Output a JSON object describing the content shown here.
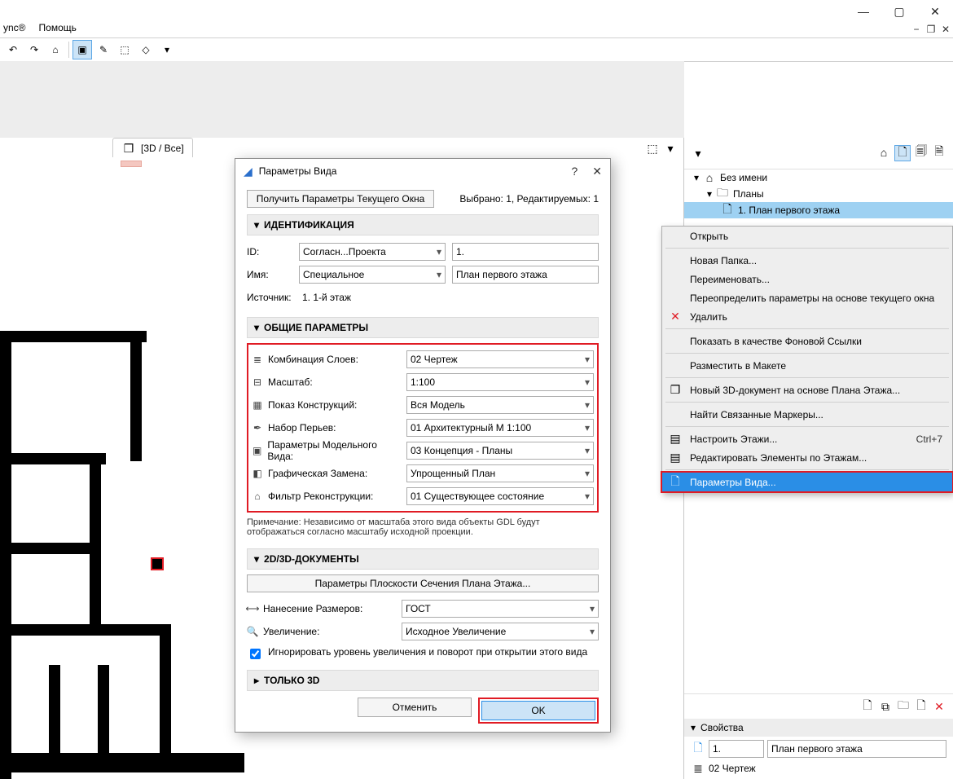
{
  "menubar": {
    "item0": "ync®",
    "item1": "Помощь"
  },
  "tab": {
    "label": "[3D / Все]"
  },
  "right_panel": {
    "root": "Без имени",
    "folder": "Планы",
    "selected_view": "1. План первого этажа",
    "props_header": "Свойства",
    "id_value": "1.",
    "name_value": "План первого этажа",
    "layer_value": "02 Чертеж"
  },
  "context_menu": {
    "open": "Открыть",
    "new_folder": "Новая Папка...",
    "rename": "Переименовать...",
    "redefine": "Переопределить параметры на основе текущего окна",
    "delete": "Удалить",
    "show_as_link": "Показать в качестве Фоновой Ссылки",
    "place_on_layout": "Разместить в Макете",
    "new_3d_doc": "Новый 3D-документ на основе Плана Этажа...",
    "find_markers": "Найти Связанные Маркеры...",
    "story_settings": "Настроить Этажи...",
    "story_settings_shortcut": "Ctrl+7",
    "edit_by_story": "Редактировать Элементы по Этажам...",
    "view_settings": "Параметры Вида..."
  },
  "dialog": {
    "title": "Параметры Вида",
    "get_current": "Получить Параметры Текущего Окна",
    "sel_info": "Выбрано: 1, Редактируемых: 1",
    "sec_id": "ИДЕНТИФИКАЦИЯ",
    "id_label": "ID:",
    "id_mode": "Согласн...Проекта",
    "id_value": "1.",
    "name_label": "Имя:",
    "name_mode": "Специальное",
    "name_value": "План первого этажа",
    "source_label": "Источник:",
    "source_value": "1. 1-й этаж",
    "sec_general": "ОБЩИЕ ПАРАМЕТРЫ",
    "layers_label": "Комбинация Слоев:",
    "layers_value": "02 Чертеж",
    "scale_label": "Масштаб:",
    "scale_value": "1:100",
    "structure_label": "Показ Конструкций:",
    "structure_value": "Вся Модель",
    "penset_label": "Набор Перьев:",
    "penset_value": "01 Архитектурный М 1:100",
    "mvo_label": "Параметры Модельного Вида:",
    "mvo_value": "03 Концепция - Планы",
    "go_label": "Графическая Замена:",
    "go_value": "Упрощенный План",
    "reno_label": "Фильтр Реконструкции:",
    "reno_value": "01 Существующее состояние",
    "note": "Примечание: Независимо от масштаба этого вида объекты GDL будут отображаться согласно масштабу исходной проекции.",
    "sec_2d3d": "2D/3D-ДОКУМЕНТЫ",
    "cut_plane_btn": "Параметры Плоскости Сечения Плана Этажа...",
    "dim_label": "Нанесение Размеров:",
    "dim_value": "ГОСТ",
    "zoom_label": "Увеличение:",
    "zoom_value": "Исходное Увеличение",
    "ignore_zoom": "Игнорировать уровень увеличения и поворот при открытии этого вида",
    "sec_3d": "ТОЛЬКО 3D",
    "cancel": "Отменить",
    "ok": "OK"
  }
}
